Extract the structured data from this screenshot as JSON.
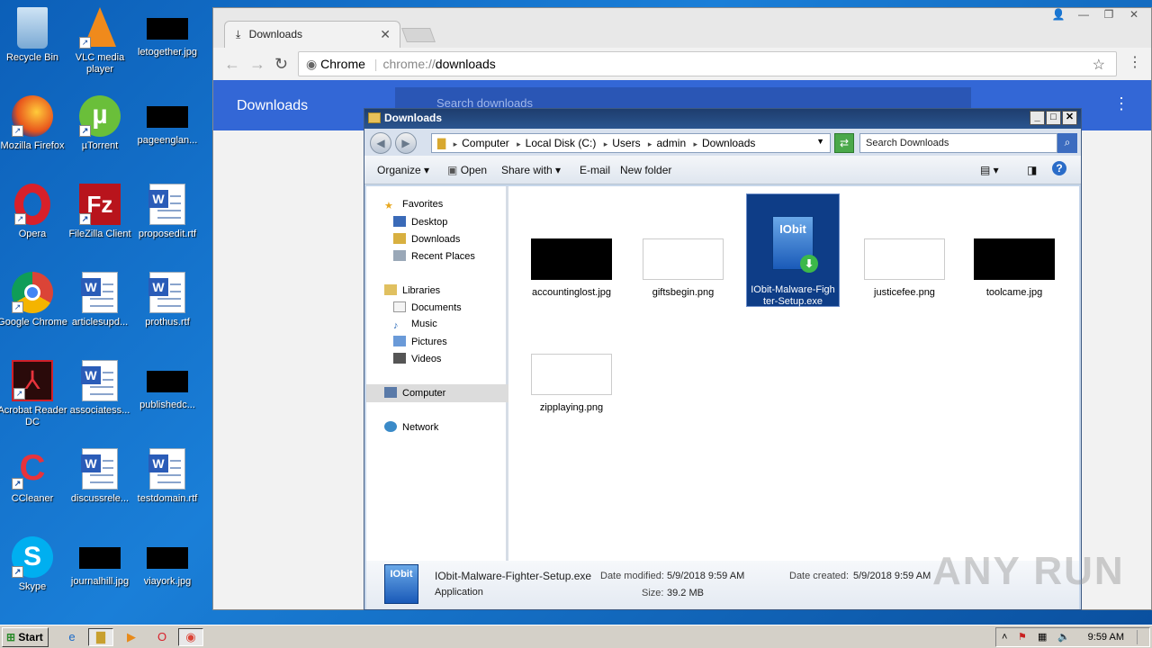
{
  "desktop": {
    "icons": [
      {
        "label": "Recycle Bin"
      },
      {
        "label": "VLC media player"
      },
      {
        "label": "letogether.jpg"
      },
      {
        "label": "Mozilla Firefox"
      },
      {
        "label": "µTorrent"
      },
      {
        "label": "pageenglan..."
      },
      {
        "label": "Opera"
      },
      {
        "label": "FileZilla Client"
      },
      {
        "label": "proposedit.rtf"
      },
      {
        "label": "Google Chrome"
      },
      {
        "label": "articlesupd..."
      },
      {
        "label": "prothus.rtf"
      },
      {
        "label": "Acrobat Reader DC"
      },
      {
        "label": "associatess..."
      },
      {
        "label": "publishedc..."
      },
      {
        "label": "CCleaner"
      },
      {
        "label": "discussrele..."
      },
      {
        "label": "testdomain.rtf"
      },
      {
        "label": "Skype"
      },
      {
        "label": "journalhill.jpg"
      },
      {
        "label": "viayork.jpg"
      }
    ]
  },
  "chrome": {
    "tab_title": "Downloads",
    "omnibox_site": "Chrome",
    "omnibox_url_scheme": "chrome://",
    "omnibox_url_path": "downloads",
    "page_title": "Downloads",
    "search_placeholder": "Search downloads"
  },
  "explorer": {
    "title": "Downloads",
    "breadcrumb": [
      "Computer",
      "Local Disk (C:)",
      "Users",
      "admin",
      "Downloads"
    ],
    "search_placeholder": "Search Downloads",
    "toolbar": {
      "organize": "Organize",
      "open": "Open",
      "share_with": "Share with",
      "email": "E-mail",
      "new_folder": "New folder"
    },
    "nav": {
      "favorites": "Favorites",
      "desktop": "Desktop",
      "downloads": "Downloads",
      "recent_places": "Recent Places",
      "libraries": "Libraries",
      "documents": "Documents",
      "music": "Music",
      "pictures": "Pictures",
      "videos": "Videos",
      "computer": "Computer",
      "network": "Network"
    },
    "files": [
      {
        "name": "accountinglost.jpg",
        "thumb": "#000000"
      },
      {
        "name": "giftsbegin.png",
        "thumb": "#ffffff"
      },
      {
        "name": "IObit-Malware-Fighter-Setup.exe",
        "icon_text": "IObit"
      },
      {
        "name": "justicefee.png",
        "thumb": "#ffffff"
      },
      {
        "name": "toolcame.jpg",
        "thumb": "#000000"
      },
      {
        "name": "zipplaying.png",
        "thumb": "#ffffff"
      }
    ],
    "details": {
      "filename": "IObit-Malware-Fighter-Setup.exe",
      "type": "Application",
      "modified_label": "Date modified:",
      "modified_value": "5/9/2018 9:59 AM",
      "size_label": "Size:",
      "size_value": "39.2 MB",
      "created_label": "Date created:",
      "created_value": "5/9/2018 9:59 AM",
      "icon_text": "IObit"
    }
  },
  "taskbar": {
    "start": "Start",
    "clock": "9:59 AM"
  },
  "watermark": "ANY RUN"
}
